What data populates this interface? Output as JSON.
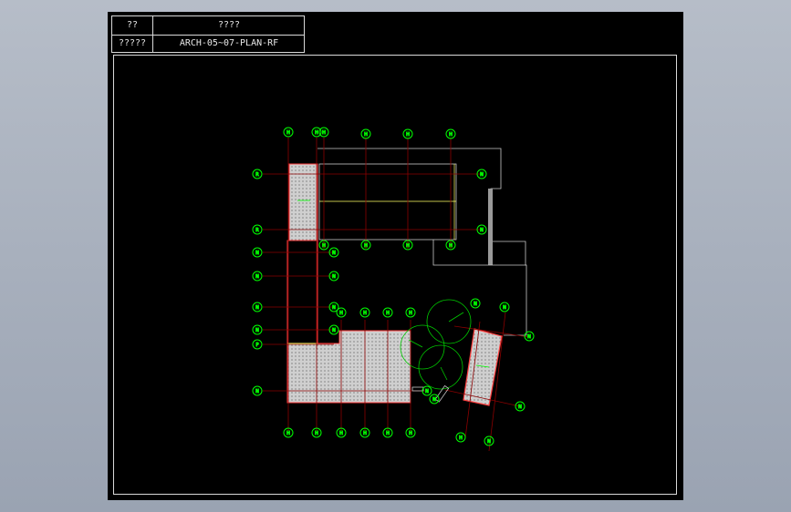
{
  "title_block": {
    "row1_label": "??",
    "row1_value": "????",
    "row2_label": "?????",
    "row2_value": "ARCH-05~07-PLAN-RF"
  },
  "colors": {
    "background": "#000000",
    "frame": "#d9d9d9",
    "grid_bubble": "#00ff00",
    "grid_line": "#8b0000",
    "wall": "#ff4040",
    "hatch_fill": "#cfcfcf",
    "outline": "#c8c8c8",
    "yellow": "#ffff66"
  },
  "grid_labels": {
    "top_row": [
      "H",
      "H",
      "H",
      "H",
      "H",
      "H"
    ],
    "left_col": [
      "R",
      "R",
      "N",
      "N",
      "N",
      "N",
      "P",
      "N"
    ],
    "bottom_row": [
      "H",
      "H",
      "H",
      "H",
      "H",
      "H"
    ],
    "right_col": [
      "N",
      "N",
      "N",
      "N",
      "N"
    ],
    "skewed": [
      "N",
      "N",
      "N",
      "H",
      "N"
    ]
  }
}
